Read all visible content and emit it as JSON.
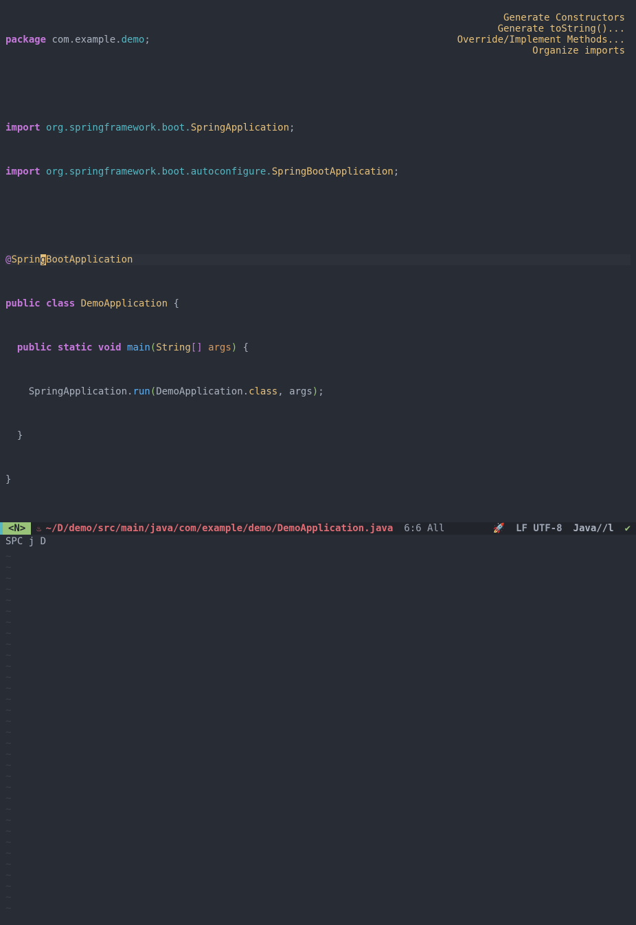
{
  "code": {
    "l1_package_kw": "package",
    "l1_pkg": " com.example.",
    "l1_demo": "demo",
    "l1_semi": ";",
    "l3_import_kw": "import",
    "l3_pkg": " org.springframework.boot.",
    "l3_cls": "SpringApplication",
    "l3_semi": ";",
    "l4_import_kw": "import",
    "l4_pkg": " org.springframework.boot.autoconfigure.",
    "l4_cls": "SpringBootApplication",
    "l4_semi": ";",
    "l6_at": "@",
    "l6_ann_a": "Sprin",
    "l6_ann_cursor": "g",
    "l6_ann_b": "BootApplication",
    "l7_public": "public",
    "l7_class": "class",
    "l7_name": "DemoApplication",
    "l7_brace": " {",
    "l8_public": "public",
    "l8_static": "static",
    "l8_void": "void",
    "l8_main": "main",
    "l8_lp": "(",
    "l8_string": "String",
    "l8_brkt": "[]",
    "l8_args": " args",
    "l8_rp": ")",
    "l8_brace": " {",
    "l9_indent": "    ",
    "l9_call_a": "SpringApplication",
    "l9_dot": ".",
    "l9_run": "run",
    "l9_lp": "(",
    "l9_arg1": "DemoApplication",
    "l9_dot2": ".",
    "l9_classkw": "class",
    "l9_comma": ", ",
    "l9_args": "args",
    "l9_rp": ")",
    "l9_semi": ";",
    "l10_brace": "  }",
    "l11_brace": "}"
  },
  "tilde": "~",
  "popup": {
    "items": [
      "Generate Constructors",
      "Generate toString()...",
      "Override/Implement Methods...",
      "Organize imports"
    ]
  },
  "modeline": {
    "mode": "<N>",
    "java_icon": "♨",
    "file": "~/D/demo/src/main/java/com/example/demo/DemoApplication.java",
    "position": "6:6 All",
    "rocket": "🚀",
    "encoding": "LF UTF-8",
    "major": "Java//l",
    "check": "✔"
  },
  "minibuffer": "SPC j D"
}
